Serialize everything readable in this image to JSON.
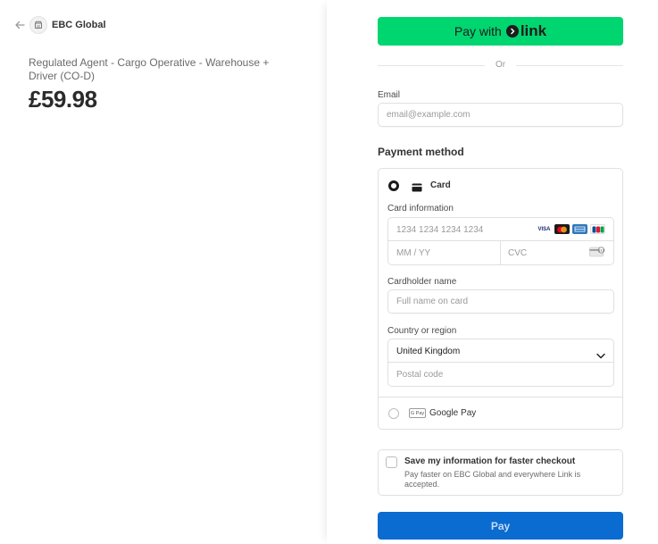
{
  "merchant": {
    "name": "EBC Global"
  },
  "product": {
    "name": "Regulated Agent - Cargo Operative - Warehouse + Driver (CO-D)",
    "price": "£59.98"
  },
  "express": {
    "pay_with_label": "Pay with",
    "link_brand": "link",
    "divider_text": "Or"
  },
  "email": {
    "label": "Email",
    "placeholder": "email@example.com"
  },
  "payment": {
    "section_title": "Payment method",
    "card_option_label": "Card",
    "card_info_label": "Card information",
    "card_number_placeholder": "1234 1234 1234 1234",
    "expiry_placeholder": "MM / YY",
    "cvc_placeholder": "CVC",
    "card_brands": [
      "VISA",
      "mastercard",
      "amex",
      "JCB"
    ],
    "cardholder_label": "Cardholder name",
    "cardholder_placeholder": "Full name on card",
    "country_label": "Country or region",
    "country_value": "United Kingdom",
    "postal_placeholder": "Postal code",
    "gpay_badge": "G Pay",
    "google_pay_label": "Google Pay"
  },
  "save_info": {
    "title": "Save my information for faster checkout",
    "description": "Pay faster on EBC Global and everywhere Link is accepted."
  },
  "pay_button": {
    "label": "Pay"
  },
  "colors": {
    "link_green": "#00d66f",
    "pay_blue": "#0a6bd1"
  }
}
